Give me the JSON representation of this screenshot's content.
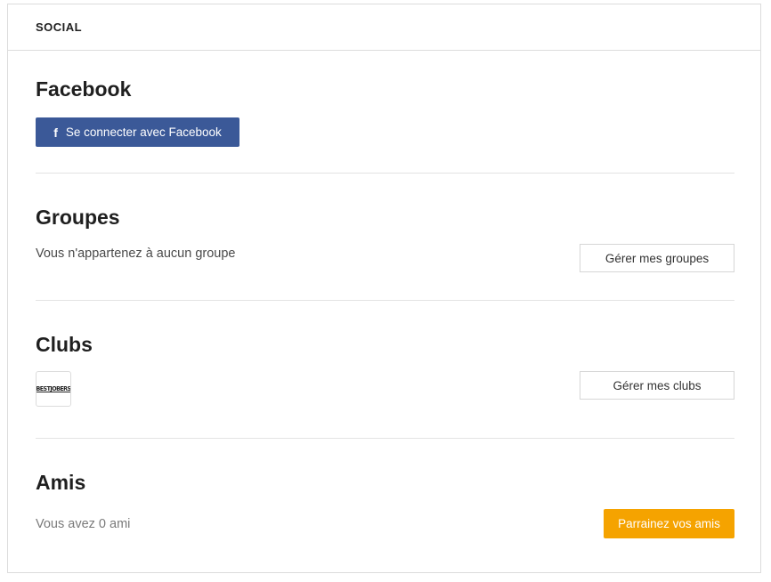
{
  "header": {
    "title": "SOCIAL"
  },
  "facebook": {
    "title": "Facebook",
    "button_label": "Se connecter avec Facebook",
    "button_icon": "facebook-f-icon",
    "button_color": "#3b5998"
  },
  "groups": {
    "title": "Groupes",
    "status_text": "Vous n'appartenez à aucun groupe",
    "manage_label": "Gérer mes groupes"
  },
  "clubs": {
    "title": "Clubs",
    "logo_text": "BESTJOBERS",
    "manage_label": "Gérer mes clubs"
  },
  "friends": {
    "title": "Amis",
    "status_text": "Vous avez 0 ami",
    "refer_label": "Parrainez vos amis",
    "refer_color": "#f5a300"
  }
}
